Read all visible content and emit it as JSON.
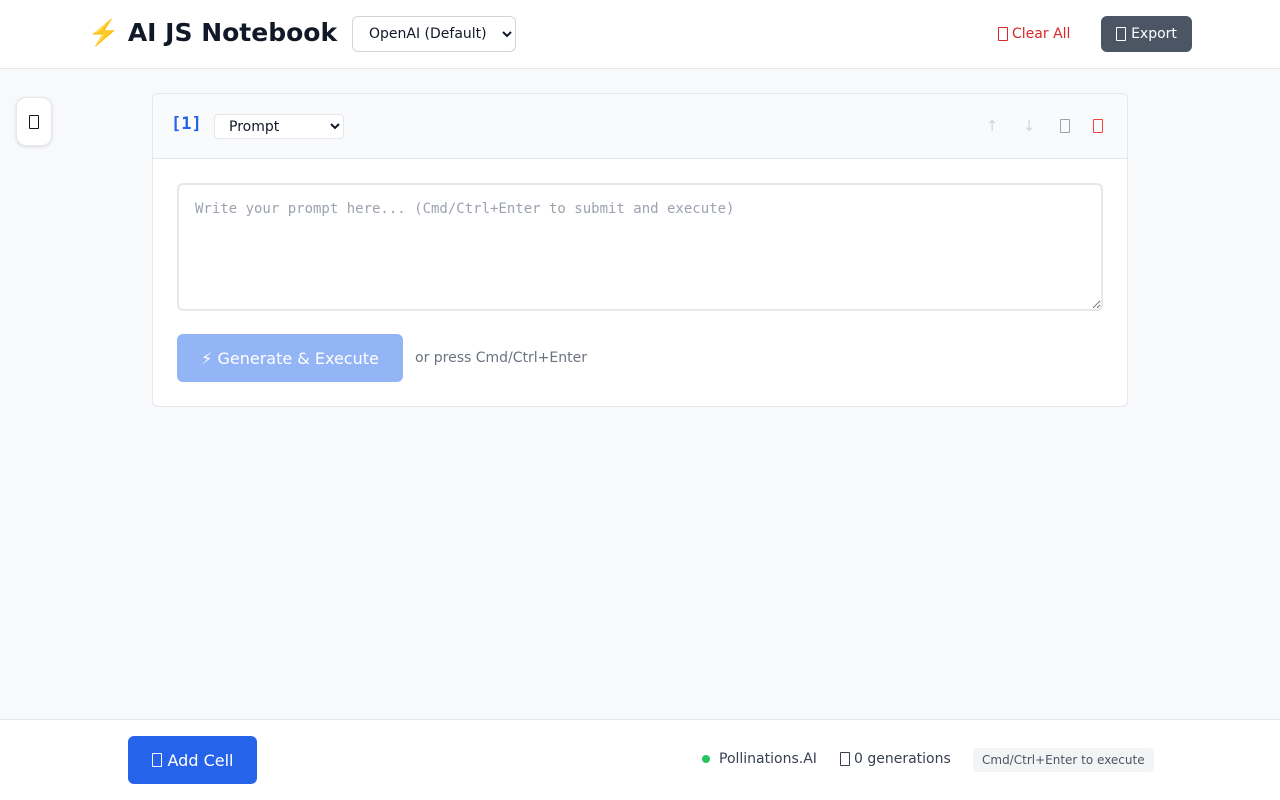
{
  "header": {
    "title": "⚡️ AI JS Notebook",
    "provider_select": {
      "selected": "OpenAI (Default)"
    },
    "clear_all_label": "Clear All",
    "export_label": "Export"
  },
  "cell": {
    "index": "[1]",
    "type_select": {
      "selected": "Prompt"
    },
    "prompt_placeholder": "Write your prompt here... (Cmd/Ctrl+Enter to submit and execute)",
    "prompt_value": "",
    "generate_label": "⚡ Generate & Execute",
    "generate_hint": "or press Cmd/Ctrl+Enter",
    "actions": {
      "move_up_icon": "↑",
      "move_down_icon": "↓"
    }
  },
  "footer": {
    "add_cell_label": "Add Cell",
    "provider_status": "Pollinations.AI",
    "generations": "0 generations",
    "shortcut_hint": "Cmd/Ctrl+Enter to execute"
  },
  "colors": {
    "accent": "#2563eb",
    "generate_disabled": "#93b4f5",
    "danger": "#dc2626",
    "export_bg": "#4b5563",
    "status_ok": "#22c55e"
  }
}
